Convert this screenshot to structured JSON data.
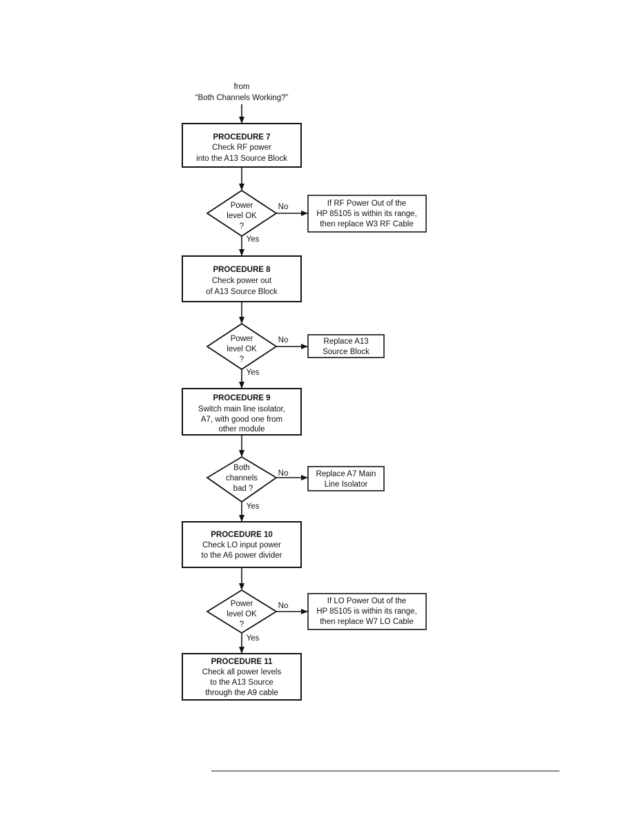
{
  "start": {
    "lines": [
      "from",
      "“Both Channels Working?”"
    ]
  },
  "procedures": [
    {
      "title": "PROCEDURE 7",
      "lines": [
        "Check RF power",
        "into the A13 Source Block"
      ]
    },
    {
      "title": "PROCEDURE 8",
      "lines": [
        "Check power out",
        "of A13 Source Block"
      ]
    },
    {
      "title": "PROCEDURE 9",
      "lines": [
        "Switch main line isolator,",
        "A7, with good one from",
        "other module"
      ]
    },
    {
      "title": "PROCEDURE 10",
      "lines": [
        "Check LO input power",
        "to the A6 power divider"
      ]
    },
    {
      "title": "PROCEDURE 11",
      "lines": [
        "Check  all power levels",
        "to the A13 Source",
        "through the A9 cable"
      ]
    }
  ],
  "decisions": [
    {
      "lines": [
        "Power",
        "level OK",
        "?"
      ],
      "no": "No",
      "yes": "Yes"
    },
    {
      "lines": [
        "Power",
        "level OK",
        "?"
      ],
      "no": "No",
      "yes": "Yes"
    },
    {
      "lines": [
        "Both",
        "channels",
        "bad ?"
      ],
      "no": "No",
      "yes": "Yes"
    },
    {
      "lines": [
        "Power",
        "level OK",
        "?"
      ],
      "no": "No",
      "yes": "Yes"
    }
  ],
  "results": [
    {
      "lines": [
        "If RF Power Out of the",
        "HP 85105 is within its range,",
        "then replace W3 RF Cable"
      ]
    },
    {
      "lines": [
        "Replace A13",
        "Source Block"
      ]
    },
    {
      "lines": [
        "Replace A7 Main",
        "Line Isolator"
      ]
    },
    {
      "lines": [
        "If LO Power Out of the",
        "HP 85105 is within its range,",
        "then replace W7 LO Cable"
      ]
    }
  ]
}
